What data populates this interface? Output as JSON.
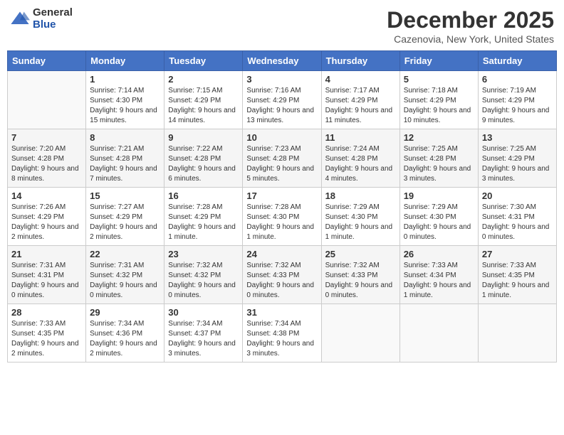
{
  "logo": {
    "general": "General",
    "blue": "Blue"
  },
  "title": "December 2025",
  "location": "Cazenovia, New York, United States",
  "days_of_week": [
    "Sunday",
    "Monday",
    "Tuesday",
    "Wednesday",
    "Thursday",
    "Friday",
    "Saturday"
  ],
  "weeks": [
    [
      {
        "day": "",
        "sunrise": "",
        "sunset": "",
        "daylight": ""
      },
      {
        "day": "1",
        "sunrise": "Sunrise: 7:14 AM",
        "sunset": "Sunset: 4:30 PM",
        "daylight": "Daylight: 9 hours and 15 minutes."
      },
      {
        "day": "2",
        "sunrise": "Sunrise: 7:15 AM",
        "sunset": "Sunset: 4:29 PM",
        "daylight": "Daylight: 9 hours and 14 minutes."
      },
      {
        "day": "3",
        "sunrise": "Sunrise: 7:16 AM",
        "sunset": "Sunset: 4:29 PM",
        "daylight": "Daylight: 9 hours and 13 minutes."
      },
      {
        "day": "4",
        "sunrise": "Sunrise: 7:17 AM",
        "sunset": "Sunset: 4:29 PM",
        "daylight": "Daylight: 9 hours and 11 minutes."
      },
      {
        "day": "5",
        "sunrise": "Sunrise: 7:18 AM",
        "sunset": "Sunset: 4:29 PM",
        "daylight": "Daylight: 9 hours and 10 minutes."
      },
      {
        "day": "6",
        "sunrise": "Sunrise: 7:19 AM",
        "sunset": "Sunset: 4:29 PM",
        "daylight": "Daylight: 9 hours and 9 minutes."
      }
    ],
    [
      {
        "day": "7",
        "sunrise": "Sunrise: 7:20 AM",
        "sunset": "Sunset: 4:28 PM",
        "daylight": "Daylight: 9 hours and 8 minutes."
      },
      {
        "day": "8",
        "sunrise": "Sunrise: 7:21 AM",
        "sunset": "Sunset: 4:28 PM",
        "daylight": "Daylight: 9 hours and 7 minutes."
      },
      {
        "day": "9",
        "sunrise": "Sunrise: 7:22 AM",
        "sunset": "Sunset: 4:28 PM",
        "daylight": "Daylight: 9 hours and 6 minutes."
      },
      {
        "day": "10",
        "sunrise": "Sunrise: 7:23 AM",
        "sunset": "Sunset: 4:28 PM",
        "daylight": "Daylight: 9 hours and 5 minutes."
      },
      {
        "day": "11",
        "sunrise": "Sunrise: 7:24 AM",
        "sunset": "Sunset: 4:28 PM",
        "daylight": "Daylight: 9 hours and 4 minutes."
      },
      {
        "day": "12",
        "sunrise": "Sunrise: 7:25 AM",
        "sunset": "Sunset: 4:28 PM",
        "daylight": "Daylight: 9 hours and 3 minutes."
      },
      {
        "day": "13",
        "sunrise": "Sunrise: 7:25 AM",
        "sunset": "Sunset: 4:29 PM",
        "daylight": "Daylight: 9 hours and 3 minutes."
      }
    ],
    [
      {
        "day": "14",
        "sunrise": "Sunrise: 7:26 AM",
        "sunset": "Sunset: 4:29 PM",
        "daylight": "Daylight: 9 hours and 2 minutes."
      },
      {
        "day": "15",
        "sunrise": "Sunrise: 7:27 AM",
        "sunset": "Sunset: 4:29 PM",
        "daylight": "Daylight: 9 hours and 2 minutes."
      },
      {
        "day": "16",
        "sunrise": "Sunrise: 7:28 AM",
        "sunset": "Sunset: 4:29 PM",
        "daylight": "Daylight: 9 hours and 1 minute."
      },
      {
        "day": "17",
        "sunrise": "Sunrise: 7:28 AM",
        "sunset": "Sunset: 4:30 PM",
        "daylight": "Daylight: 9 hours and 1 minute."
      },
      {
        "day": "18",
        "sunrise": "Sunrise: 7:29 AM",
        "sunset": "Sunset: 4:30 PM",
        "daylight": "Daylight: 9 hours and 1 minute."
      },
      {
        "day": "19",
        "sunrise": "Sunrise: 7:29 AM",
        "sunset": "Sunset: 4:30 PM",
        "daylight": "Daylight: 9 hours and 0 minutes."
      },
      {
        "day": "20",
        "sunrise": "Sunrise: 7:30 AM",
        "sunset": "Sunset: 4:31 PM",
        "daylight": "Daylight: 9 hours and 0 minutes."
      }
    ],
    [
      {
        "day": "21",
        "sunrise": "Sunrise: 7:31 AM",
        "sunset": "Sunset: 4:31 PM",
        "daylight": "Daylight: 9 hours and 0 minutes."
      },
      {
        "day": "22",
        "sunrise": "Sunrise: 7:31 AM",
        "sunset": "Sunset: 4:32 PM",
        "daylight": "Daylight: 9 hours and 0 minutes."
      },
      {
        "day": "23",
        "sunrise": "Sunrise: 7:32 AM",
        "sunset": "Sunset: 4:32 PM",
        "daylight": "Daylight: 9 hours and 0 minutes."
      },
      {
        "day": "24",
        "sunrise": "Sunrise: 7:32 AM",
        "sunset": "Sunset: 4:33 PM",
        "daylight": "Daylight: 9 hours and 0 minutes."
      },
      {
        "day": "25",
        "sunrise": "Sunrise: 7:32 AM",
        "sunset": "Sunset: 4:33 PM",
        "daylight": "Daylight: 9 hours and 0 minutes."
      },
      {
        "day": "26",
        "sunrise": "Sunrise: 7:33 AM",
        "sunset": "Sunset: 4:34 PM",
        "daylight": "Daylight: 9 hours and 1 minute."
      },
      {
        "day": "27",
        "sunrise": "Sunrise: 7:33 AM",
        "sunset": "Sunset: 4:35 PM",
        "daylight": "Daylight: 9 hours and 1 minute."
      }
    ],
    [
      {
        "day": "28",
        "sunrise": "Sunrise: 7:33 AM",
        "sunset": "Sunset: 4:35 PM",
        "daylight": "Daylight: 9 hours and 2 minutes."
      },
      {
        "day": "29",
        "sunrise": "Sunrise: 7:34 AM",
        "sunset": "Sunset: 4:36 PM",
        "daylight": "Daylight: 9 hours and 2 minutes."
      },
      {
        "day": "30",
        "sunrise": "Sunrise: 7:34 AM",
        "sunset": "Sunset: 4:37 PM",
        "daylight": "Daylight: 9 hours and 3 minutes."
      },
      {
        "day": "31",
        "sunrise": "Sunrise: 7:34 AM",
        "sunset": "Sunset: 4:38 PM",
        "daylight": "Daylight: 9 hours and 3 minutes."
      },
      {
        "day": "",
        "sunrise": "",
        "sunset": "",
        "daylight": ""
      },
      {
        "day": "",
        "sunrise": "",
        "sunset": "",
        "daylight": ""
      },
      {
        "day": "",
        "sunrise": "",
        "sunset": "",
        "daylight": ""
      }
    ]
  ]
}
